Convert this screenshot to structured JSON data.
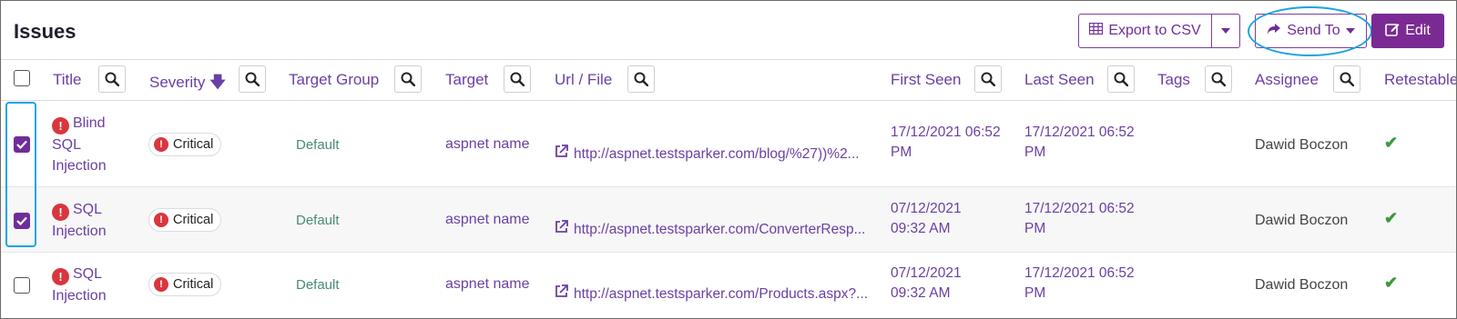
{
  "page": {
    "title": "Issues"
  },
  "toolbar": {
    "export_label": "Export to CSV",
    "send_label": "Send To",
    "edit_label": "Edit"
  },
  "columns": {
    "title": "Title",
    "severity": "Severity",
    "target_group": "Target Group",
    "target": "Target",
    "url": "Url / File",
    "first_seen": "First Seen",
    "last_seen": "Last Seen",
    "tags": "Tags",
    "assignee": "Assignee",
    "retestable": "Retestable"
  },
  "rows": [
    {
      "checked": true,
      "title": "Blind SQL Injection",
      "severity": "Critical",
      "target_group": "Default",
      "target": "aspnet name",
      "url": "http://aspnet.testsparker.com/blog/%27))%2...",
      "first_seen": "17/12/2021 06:52 PM",
      "last_seen": "17/12/2021 06:52 PM",
      "assignee": "Dawid Boczon",
      "retestable": "✔"
    },
    {
      "checked": true,
      "title": "SQL Injection",
      "severity": "Critical",
      "target_group": "Default",
      "target": "aspnet name",
      "url": "http://aspnet.testsparker.com/ConverterResp...",
      "first_seen": "07/12/2021 09:32 AM",
      "last_seen": "17/12/2021 06:52 PM",
      "assignee": "Dawid Boczon",
      "retestable": "✔"
    },
    {
      "checked": false,
      "title": "SQL Injection",
      "severity": "Critical",
      "target_group": "Default",
      "target": "aspnet name",
      "url": "http://aspnet.testsparker.com/Products.aspx?...",
      "first_seen": "07/12/2021 09:32 AM",
      "last_seen": "17/12/2021 06:52 PM",
      "assignee": "Dawid Boczon",
      "retestable": "✔"
    }
  ],
  "colors": {
    "accent": "#7b2a93",
    "link": "#6a3fa3",
    "critical": "#d9363e",
    "highlight": "#1ba4e0",
    "check": "#3a9a3a"
  },
  "icons": {
    "export": "table-icon",
    "send": "share-arrow-icon",
    "edit": "edit-icon",
    "search": "search-icon",
    "sort": "arrow-down-icon",
    "severity": "exclamation-circle-icon",
    "url": "external-link-icon",
    "retestable": "check-icon"
  }
}
